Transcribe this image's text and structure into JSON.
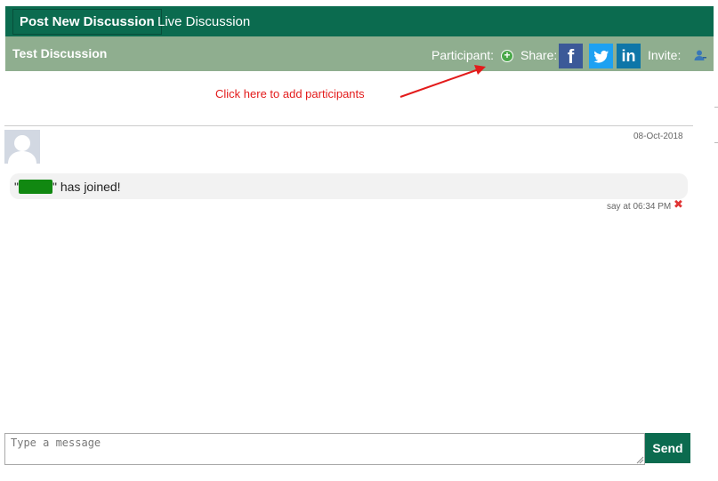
{
  "tabs": {
    "post_new": "Post New Discussion",
    "live": "Live Discussion"
  },
  "discussion": {
    "title": "Test Discussion",
    "participant_label": "Participant:",
    "share_label": "Share:",
    "invite_label": "Invite:"
  },
  "social": {
    "facebook_glyph": "f",
    "linkedin_glyph": "in"
  },
  "hint": {
    "text": "Click here to add participants",
    "color": "#e31b1b"
  },
  "message": {
    "date": "08-Oct-2018",
    "quote_open": "\"",
    "quote_close": "\"",
    "text": " has joined!",
    "meta": "say at 06:34 PM"
  },
  "composer": {
    "placeholder": "Type a message",
    "send_label": "Send"
  },
  "colors": {
    "primary": "#0b6b4f",
    "subbar": "#8fae8f"
  }
}
